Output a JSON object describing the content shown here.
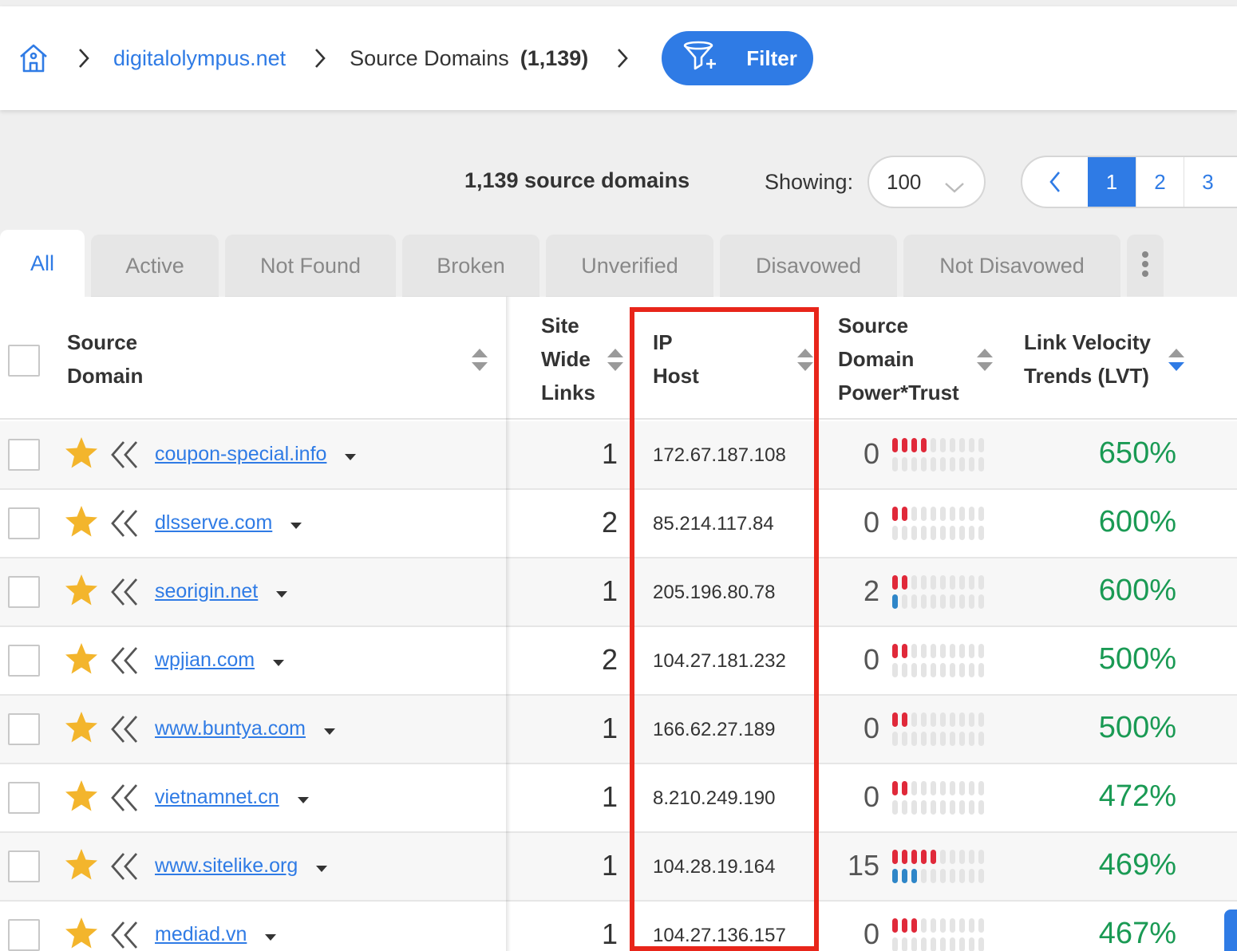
{
  "breadcrumb": {
    "domain": "digitalolympus.net",
    "section": "Source Domains",
    "count": "(1,139)"
  },
  "filter_button": {
    "label": "Filter"
  },
  "toolbar": {
    "count_text": "1,139 source domains",
    "showing_label": "Showing:",
    "showing_value": "100",
    "pages": [
      "1",
      "2",
      "3"
    ],
    "active_page": "1"
  },
  "tabs": [
    {
      "label": "All",
      "active": true
    },
    {
      "label": "Active",
      "active": false
    },
    {
      "label": "Not Found",
      "active": false
    },
    {
      "label": "Broken",
      "active": false
    },
    {
      "label": "Unverified",
      "active": false
    },
    {
      "label": "Disavowed",
      "active": false
    },
    {
      "label": "Not Disavowed",
      "active": false
    }
  ],
  "columns": {
    "source_domain": [
      "Source",
      "Domain"
    ],
    "site_wide_links": [
      "Site",
      "Wide",
      "Links"
    ],
    "ip_host": [
      "IP",
      "Host"
    ],
    "power_trust": [
      "Source",
      "Domain",
      "Power*Trust"
    ],
    "lvt": [
      "Link Velocity",
      "Trends (LVT)"
    ]
  },
  "rows": [
    {
      "domain": "coupon-special.info",
      "site_wide_links": "1",
      "ip": "172.67.187.108",
      "power_trust": "0",
      "power_level": 4,
      "trust_level": 0,
      "lvt": "650%"
    },
    {
      "domain": "dlsserve.com",
      "site_wide_links": "2",
      "ip": "85.214.117.84",
      "power_trust": "0",
      "power_level": 2,
      "trust_level": 0,
      "lvt": "600%"
    },
    {
      "domain": "seorigin.net",
      "site_wide_links": "1",
      "ip": "205.196.80.78",
      "power_trust": "2",
      "power_level": 2,
      "trust_level": 1,
      "lvt": "600%"
    },
    {
      "domain": "wpjian.com",
      "site_wide_links": "2",
      "ip": "104.27.181.232",
      "power_trust": "0",
      "power_level": 2,
      "trust_level": 0,
      "lvt": "500%"
    },
    {
      "domain": "www.buntya.com",
      "site_wide_links": "1",
      "ip": "166.62.27.189",
      "power_trust": "0",
      "power_level": 2,
      "trust_level": 0,
      "lvt": "500%"
    },
    {
      "domain": "vietnamnet.cn",
      "site_wide_links": "1",
      "ip": "8.210.249.190",
      "power_trust": "0",
      "power_level": 2,
      "trust_level": 0,
      "lvt": "472%"
    },
    {
      "domain": "www.sitelike.org",
      "site_wide_links": "1",
      "ip": "104.28.19.164",
      "power_trust": "15",
      "power_level": 5,
      "trust_level": 3,
      "lvt": "469%"
    },
    {
      "domain": "mediad.vn",
      "site_wide_links": "1",
      "ip": "104.27.136.157",
      "power_trust": "0",
      "power_level": 3,
      "trust_level": 0,
      "lvt": "467%"
    }
  ],
  "colors": {
    "accent": "#2f7be5",
    "power_bar": "#e0293a",
    "trust_bar": "#2f86c8",
    "lvt_positive": "#1a9a54",
    "highlight": "#e8251a",
    "star": "#f3b52c"
  }
}
